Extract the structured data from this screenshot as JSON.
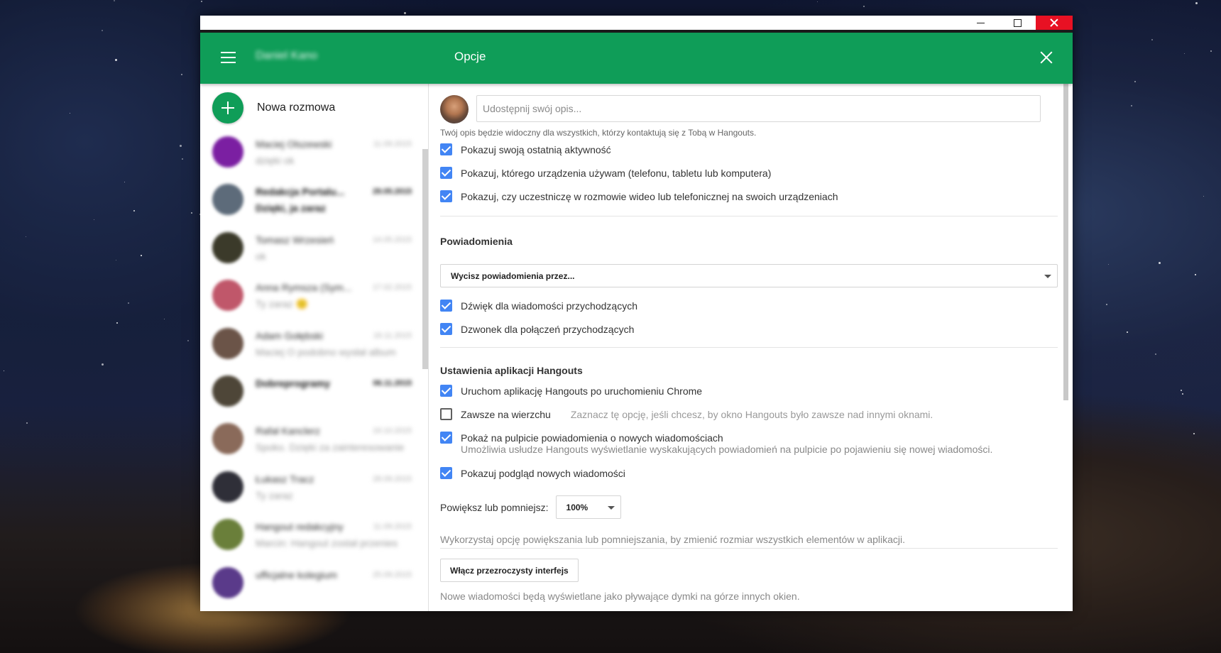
{
  "window": {
    "controls": [
      "minimize",
      "maximize",
      "close"
    ]
  },
  "appbar": {
    "user_name": "Daniel Kano",
    "title": "Opcje",
    "menu_icon": "hamburger-menu-icon",
    "close_icon": "close-icon"
  },
  "sidebar": {
    "new_conversation_label": "Nowa rozmowa",
    "conversations": [
      {
        "name": "Maciej Olszewski",
        "message": "dzięki ok",
        "time": "11.09.2015",
        "avatar_color": "#7b1fa2",
        "unread": false
      },
      {
        "name": "Redakcja Portalu...",
        "message": "Dzięki, ja zaraz",
        "time": "29.05.2015",
        "avatar_color": "#5d6b7a",
        "unread": true
      },
      {
        "name": "Tomasz Wrzesień",
        "message": "ok",
        "time": "14.05.2015",
        "avatar_color": "#3b3a2a",
        "unread": false
      },
      {
        "name": "Anna Rymsza (Sym...",
        "message": "Ty zaraz 🙂",
        "time": "17.02.2015",
        "avatar_color": "#c0576a",
        "unread": false
      },
      {
        "name": "Adam Gołębski",
        "message": "Maciej O podobno wysłał album",
        "time": "16.11.2015",
        "avatar_color": "#6b5448",
        "unread": false
      },
      {
        "name": "Dobreprogramy",
        "message": "",
        "time": "06.11.2015",
        "avatar_color": "#4e4638",
        "unread": true
      },
      {
        "name": "Rafał Kanclerz",
        "message": "Spoko. Dzięki za zainteresowanie",
        "time": "19.10.2015",
        "avatar_color": "#8a6a5a",
        "unread": false
      },
      {
        "name": "Łukasz Tracz",
        "message": "Ty zaraz",
        "time": "28.09.2015",
        "avatar_color": "#2f2f38",
        "unread": false
      },
      {
        "name": "Hangout redakcyjny",
        "message": "Marcin: Hangout został przenies",
        "time": "11.09.2015",
        "avatar_color": "#6a7f3a",
        "unread": false
      },
      {
        "name": "ufficjalne kolegium",
        "message": "",
        "time": "25.09.2015",
        "avatar_color": "#5a3a8a",
        "unread": false
      }
    ]
  },
  "options": {
    "mood_placeholder": "Udostępnij swój opis...",
    "mood_hint": "Twój opis będzie widoczny dla wszystkich, którzy kontaktują się z Tobą w Hangouts.",
    "privacy": [
      {
        "label": "Pokazuj swoją ostatnią aktywność",
        "checked": true
      },
      {
        "label": "Pokazuj, którego urządzenia używam (telefonu, tabletu lub komputera)",
        "checked": true
      },
      {
        "label": "Pokazuj, czy uczestniczę w rozmowie wideo lub telefonicznej na swoich urządzeniach",
        "checked": true
      }
    ],
    "notifications": {
      "title": "Powiadomienia",
      "mute_select": "Wycisz powiadomienia przez...",
      "items": [
        {
          "label": "Dźwięk dla wiadomości przychodzących",
          "checked": true
        },
        {
          "label": "Dzwonek dla połączeń przychodzących",
          "checked": true
        }
      ]
    },
    "app_settings": {
      "title": "Ustawienia aplikacji Hangouts",
      "launch_chrome": {
        "label": "Uruchom aplikację Hangouts po uruchomieniu Chrome",
        "checked": true
      },
      "always_on_top": {
        "label": "Zawsze na wierzchu",
        "hint": "Zaznacz tę opcję, jeśli chcesz, by okno Hangouts było zawsze nad innymi oknami.",
        "checked": false
      },
      "desktop_notify": {
        "label": "Pokaż na pulpicie powiadomienia o nowych wiadomościach",
        "hint": "Umożliwia usłudze Hangouts wyświetlanie wyskakujących powiadomień na pulpicie po pojawieniu się nowej wiadomości.",
        "checked": true
      },
      "preview": {
        "label": "Pokazuj podgląd nowych wiadomości",
        "checked": true
      },
      "zoom_label": "Powiększ lub pomniejsz:",
      "zoom_value": "100%",
      "zoom_hint": "Wykorzystaj opcję powiększania lub pomniejszania, by zmienić rozmiar wszystkich elementów w aplikacji.",
      "transparent_button": "Włącz przezroczysty interfejs",
      "transparent_hint": "Nowe wiadomości będą wyświetlane jako pływające dymki na górze innych okien."
    }
  },
  "colors": {
    "accent": "#0f9d58",
    "checkbox": "#4285f4",
    "close_hover": "#e81123"
  }
}
